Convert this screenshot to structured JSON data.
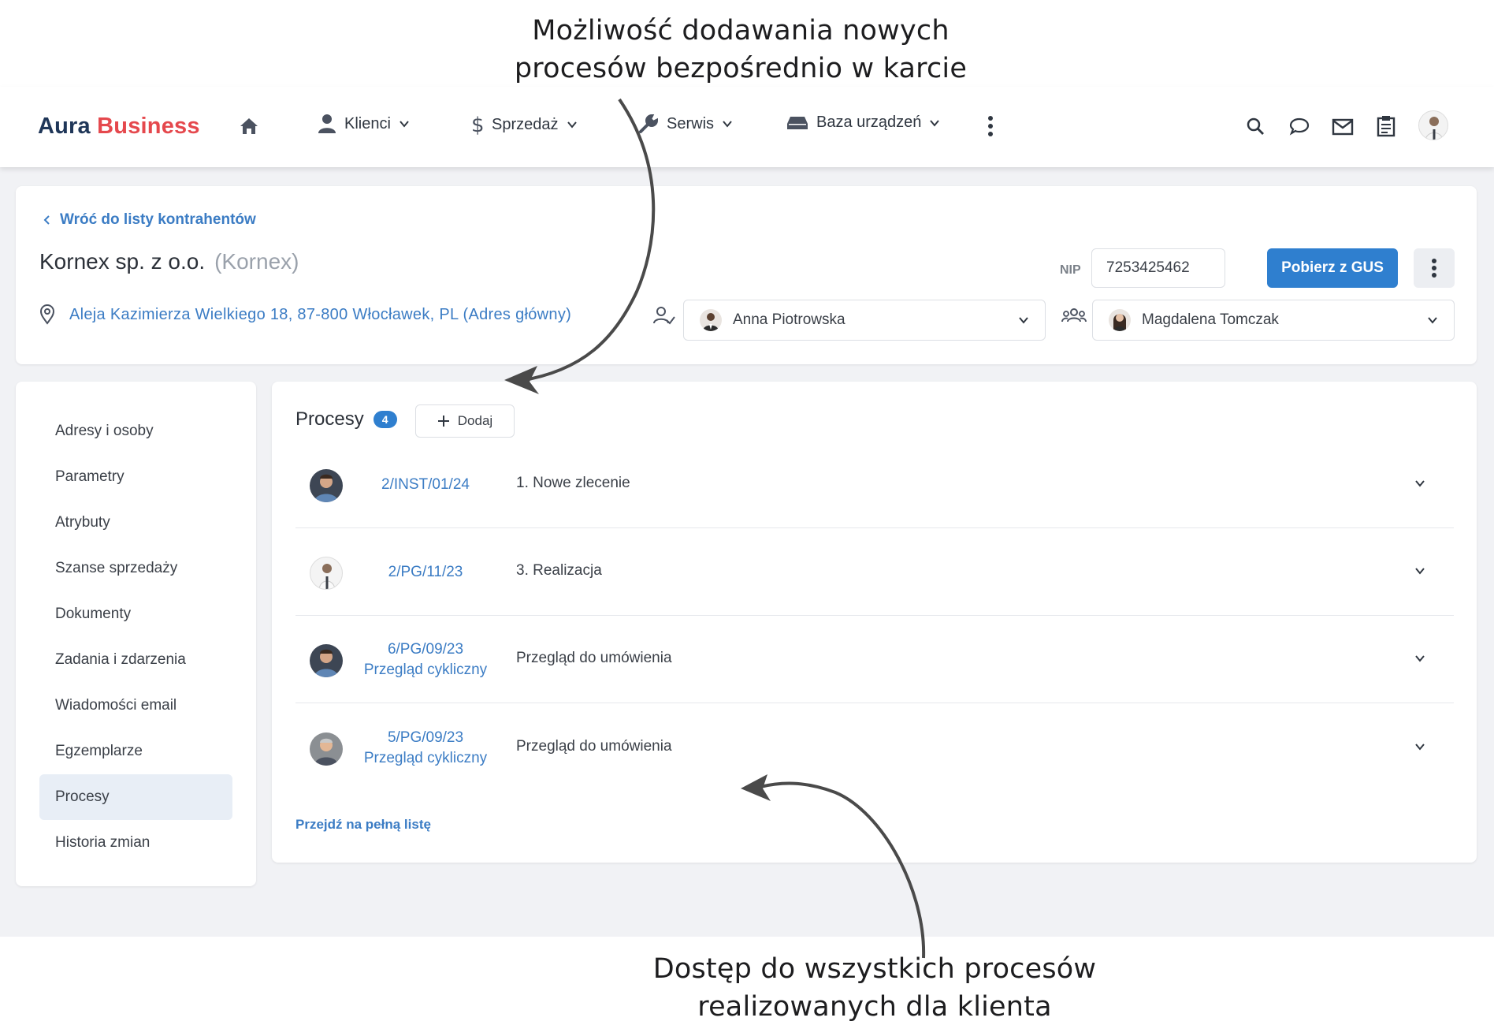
{
  "annotations": {
    "top": [
      "Możliwość dodawania nowych",
      "procesów bezpośrednio w karcie"
    ],
    "bottom": [
      "Dostęp do wszystkich procesów",
      "realizowanych dla klienta"
    ]
  },
  "brand": {
    "part1": "Aura",
    "part2": "Business",
    "color1": "#1f3658",
    "color2": "#e5484d"
  },
  "nav": {
    "items": [
      {
        "label": "Klienci",
        "icon": "user-icon"
      },
      {
        "label": "Sprzedaż",
        "icon": "dollar-icon"
      },
      {
        "label": "Serwis",
        "icon": "wrench-icon"
      },
      {
        "label": "Baza urządzeń",
        "icon": "device-icon"
      }
    ]
  },
  "header": {
    "back_label": "Wróć do listy kontrahentów",
    "company_name": "Kornex sp. z o.o.",
    "company_short": "(Kornex)",
    "nip_label": "NIP",
    "nip_value": "7253425462",
    "gus_button": "Pobierz z GUS",
    "address": "Aleja Kazimierza Wielkiego 18, 87-800 Włocławek, PL (Adres główny)",
    "owner": "Anna Piotrowska",
    "team": "Magdalena Tomczak"
  },
  "sidebar": {
    "items": [
      {
        "label": "Adresy i osoby"
      },
      {
        "label": "Parametry"
      },
      {
        "label": "Atrybuty"
      },
      {
        "label": "Szanse sprzedaży"
      },
      {
        "label": "Dokumenty"
      },
      {
        "label": "Zadania i zdarzenia"
      },
      {
        "label": "Wiadomości email"
      },
      {
        "label": "Egzemplarze"
      },
      {
        "label": "Procesy",
        "active": true
      },
      {
        "label": "Historia zmian"
      }
    ]
  },
  "processes": {
    "title": "Procesy",
    "count": "4",
    "add_label": "Dodaj",
    "rows": [
      {
        "code": "2/INST/01/24",
        "subtitle": "",
        "status": "1. Nowe zlecenie"
      },
      {
        "code": "2/PG/11/23",
        "subtitle": "",
        "status": "3. Realizacja"
      },
      {
        "code": "6/PG/09/23",
        "subtitle": "Przegląd cykliczny",
        "status": "Przegląd do umówienia"
      },
      {
        "code": "5/PG/09/23",
        "subtitle": "Przegląd cykliczny",
        "status": "Przegląd do umówienia"
      }
    ],
    "full_list_link": "Przejdź na pełną listę"
  },
  "colors": {
    "accent": "#2f7fcf",
    "link": "#3b7cc4",
    "background": "#f1f2f5"
  }
}
